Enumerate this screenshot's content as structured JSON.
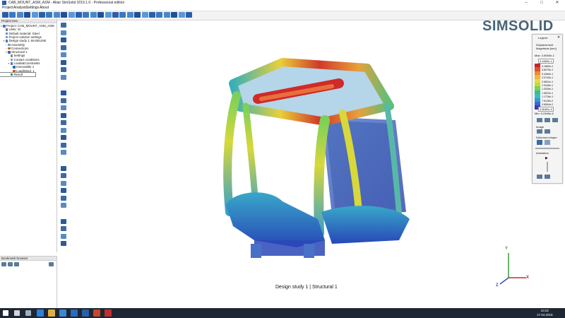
{
  "window": {
    "title": "CAB_MOUNT_ASM_ASM - Altair SimSolid 2019.1.0 - Professional edition",
    "controls": [
      "–",
      "□",
      "✕"
    ]
  },
  "menu": [
    "Project",
    "Analysis",
    "Settings",
    "About"
  ],
  "toolbar": {
    "icons": [
      "new-project-icon",
      "open-project-icon",
      "save-icon",
      "save-as-icon",
      "import-icon",
      "export-icon",
      "tree-view-icon",
      "list-view-icon",
      "fit-icon",
      "cut-icon",
      "settings-icon",
      "wrench-icon",
      "camera-icon",
      "chart-icon",
      "zoom-icon",
      "rotate-icon",
      "layers-icon",
      "mesh-icon",
      "solid-icon",
      "wireframe-icon",
      "view-front-icon",
      "load-icon",
      "constraint-icon",
      "contact-icon",
      "material-icon",
      "help-icon"
    ]
  },
  "project_tree": {
    "header": "Project tree",
    "items": [
      {
        "label": "Project: CAB_MOUNT_ASM_ASM",
        "level": 0,
        "expander": "▾",
        "color": "#4a72b8"
      },
      {
        "label": "Units: SI",
        "level": 1,
        "expander": "",
        "color": "#7a7a7a"
      },
      {
        "label": "Default material: Steel",
        "level": 1,
        "expander": "",
        "color": "#5a8fd0"
      },
      {
        "label": "Project solution settings",
        "level": 1,
        "expander": "",
        "color": "#6aa0c8"
      },
      {
        "label": "Design study 1: BASELINE",
        "level": 1,
        "expander": "▾",
        "color": "#4a72b8"
      },
      {
        "label": "Assembly",
        "level": 2,
        "expander": "›",
        "color": "#7aa0c0"
      },
      {
        "label": "Connections",
        "level": 2,
        "expander": "›",
        "color": "#c07a2a"
      },
      {
        "label": "Structural 1",
        "level": 2,
        "expander": "▾",
        "color": "#3a6ab0"
      },
      {
        "label": "Settings",
        "level": 3,
        "expander": "",
        "color": "#8a8a8a"
      },
      {
        "label": "Contact conditions",
        "level": 3,
        "expander": "›",
        "color": "#7a9ac0"
      },
      {
        "label": "Loads&Constraints",
        "level": 3,
        "expander": "▾",
        "color": "#5a7aa0"
      },
      {
        "label": "Immovable 1",
        "level": 4,
        "expander": "",
        "color": "#2a6ac0"
      },
      {
        "label": "Load/Displ. 1",
        "level": 4,
        "expander": "",
        "color": "#c05a2a"
      },
      {
        "label": "Result",
        "level": 3,
        "expander": "",
        "color": "#2a9a5a",
        "selected": true
      }
    ]
  },
  "bookmark_browser": {
    "header": "Bookmark browser",
    "icons": [
      "bookmark-add-icon",
      "bookmark-edit-icon",
      "bookmark-delete-icon",
      "bookmark-settings-icon"
    ]
  },
  "side_toolbar": {
    "icons": [
      "view-top-icon",
      "view-bottom-icon",
      "view-left-icon",
      "view-right-icon",
      "view-front-icon",
      "view-back-icon",
      "view-iso-icon",
      "view-fit-icon",
      "pan-icon",
      "rotate-icon",
      "zoom-icon",
      "section-icon",
      "measure-icon",
      "probe-icon",
      "hide-icon",
      "show-icon",
      "transparency-icon",
      "color-icon",
      "edge-icon",
      "deformed-icon",
      "undeformed-icon",
      "animate-icon",
      "legend-icon",
      "label-icon",
      "plot-icon",
      "report-icon",
      "export-icon"
    ]
  },
  "viewport": {
    "logo": "SIMSOLID",
    "caption": "Design study 1 | Structural 1",
    "triad": {
      "x": "X",
      "y": "Y",
      "z": "Z"
    }
  },
  "legend": {
    "title": "Legend",
    "quantity_line1": "Displacement",
    "quantity_line2": "Magnitude [mm]",
    "max_label": "Max: 4.5693e-1",
    "max_value": "4.1869e-1",
    "values": [
      "4.1869e-1",
      "3.8079e-1",
      "3.4469e-1",
      "3.0743e-1",
      "2.6631e-1",
      "2.3046e-1",
      "1.9339e-1",
      "1.5522e-1",
      "1.1716e-1",
      "7.6128e-2",
      "3.8064e-2"
    ],
    "min_value": "3.8082e-2",
    "min_label": "Min: 6.2469e-6",
    "colors": [
      "#c0282a",
      "#e0502a",
      "#f08a2a",
      "#f0b83a",
      "#e8dc3a",
      "#b8e03a",
      "#7ad05a",
      "#3ac080",
      "#38c0c0",
      "#3898d8",
      "#3a6ad0",
      "#3a3ac0"
    ],
    "image_label": "Image",
    "deformed_label": "Deformed shape",
    "animation_label": "Animation"
  },
  "taskbar": {
    "icons": [
      "windows-start-icon",
      "search-icon",
      "task-view-icon",
      "edge-browser-icon",
      "file-explorer-icon",
      "store-icon",
      "mail-icon",
      "simsolid-taskbar-icon",
      "powerpoint-icon",
      "other-app-icon"
    ],
    "time": "10:22",
    "date": "17.04.2019"
  }
}
